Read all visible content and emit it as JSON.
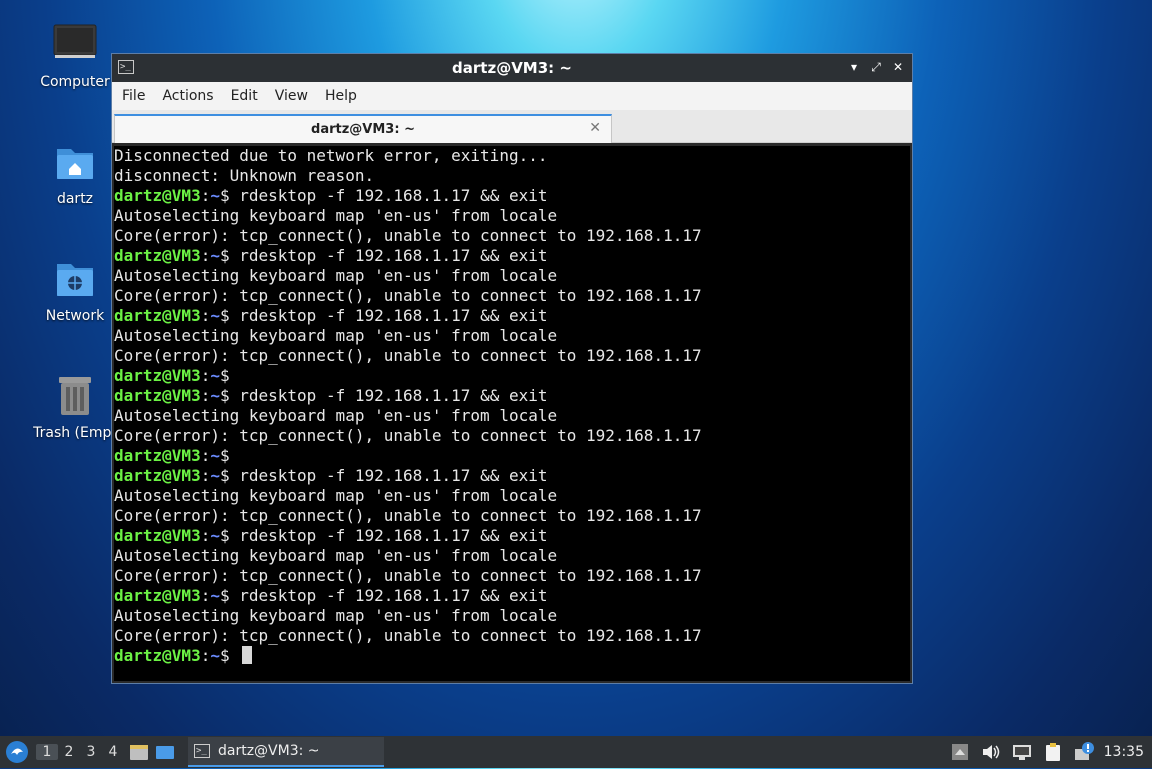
{
  "desktop": {
    "icons": [
      {
        "label": "Computer"
      },
      {
        "label": "dartz"
      },
      {
        "label": "Network"
      },
      {
        "label": "Trash (Empt"
      }
    ]
  },
  "window": {
    "title": "dartz@VM3: ~",
    "menu": [
      "File",
      "Actions",
      "Edit",
      "View",
      "Help"
    ],
    "tab": {
      "label": "dartz@VM3: ~"
    },
    "prompt": {
      "user": "dartz@VM3",
      "path": "~"
    },
    "terminal_lines": [
      {
        "text": "Disconnected due to network error, exiting..."
      },
      {
        "text": "disconnect: Unknown reason."
      },
      {
        "prompt": true,
        "cmd": " rdesktop -f 192.168.1.17 && exit"
      },
      {
        "text": "Autoselecting keyboard map 'en-us' from locale"
      },
      {
        "text": "Core(error): tcp_connect(), unable to connect to 192.168.1.17"
      },
      {
        "prompt": true,
        "cmd": " rdesktop -f 192.168.1.17 && exit"
      },
      {
        "text": "Autoselecting keyboard map 'en-us' from locale"
      },
      {
        "text": "Core(error): tcp_connect(), unable to connect to 192.168.1.17"
      },
      {
        "prompt": true,
        "cmd": " rdesktop -f 192.168.1.17 && exit"
      },
      {
        "text": "Autoselecting keyboard map 'en-us' from locale"
      },
      {
        "text": "Core(error): tcp_connect(), unable to connect to 192.168.1.17"
      },
      {
        "prompt": true,
        "cmd": ""
      },
      {
        "prompt": true,
        "cmd": " rdesktop -f 192.168.1.17 && exit"
      },
      {
        "text": "Autoselecting keyboard map 'en-us' from locale"
      },
      {
        "text": "Core(error): tcp_connect(), unable to connect to 192.168.1.17"
      },
      {
        "prompt": true,
        "cmd": ""
      },
      {
        "prompt": true,
        "cmd": " rdesktop -f 192.168.1.17 && exit"
      },
      {
        "text": "Autoselecting keyboard map 'en-us' from locale"
      },
      {
        "text": "Core(error): tcp_connect(), unable to connect to 192.168.1.17"
      },
      {
        "prompt": true,
        "cmd": " rdesktop -f 192.168.1.17 && exit"
      },
      {
        "text": "Autoselecting keyboard map 'en-us' from locale"
      },
      {
        "text": "Core(error): tcp_connect(), unable to connect to 192.168.1.17"
      },
      {
        "prompt": true,
        "cmd": " rdesktop -f 192.168.1.17 && exit"
      },
      {
        "text": "Autoselecting keyboard map 'en-us' from locale"
      },
      {
        "text": "Core(error): tcp_connect(), unable to connect to 192.168.1.17"
      },
      {
        "prompt": true,
        "cmd": " ",
        "cursor": true
      }
    ]
  },
  "taskbar": {
    "workspaces": [
      "1",
      "2",
      "3",
      "4"
    ],
    "active_workspace": "1",
    "task_label": "dartz@VM3: ~",
    "clock": "13:35"
  },
  "colors": {
    "prompt_user": "#6cf245",
    "prompt_path": "#6b8cff",
    "accent": "#3d8ee0"
  }
}
